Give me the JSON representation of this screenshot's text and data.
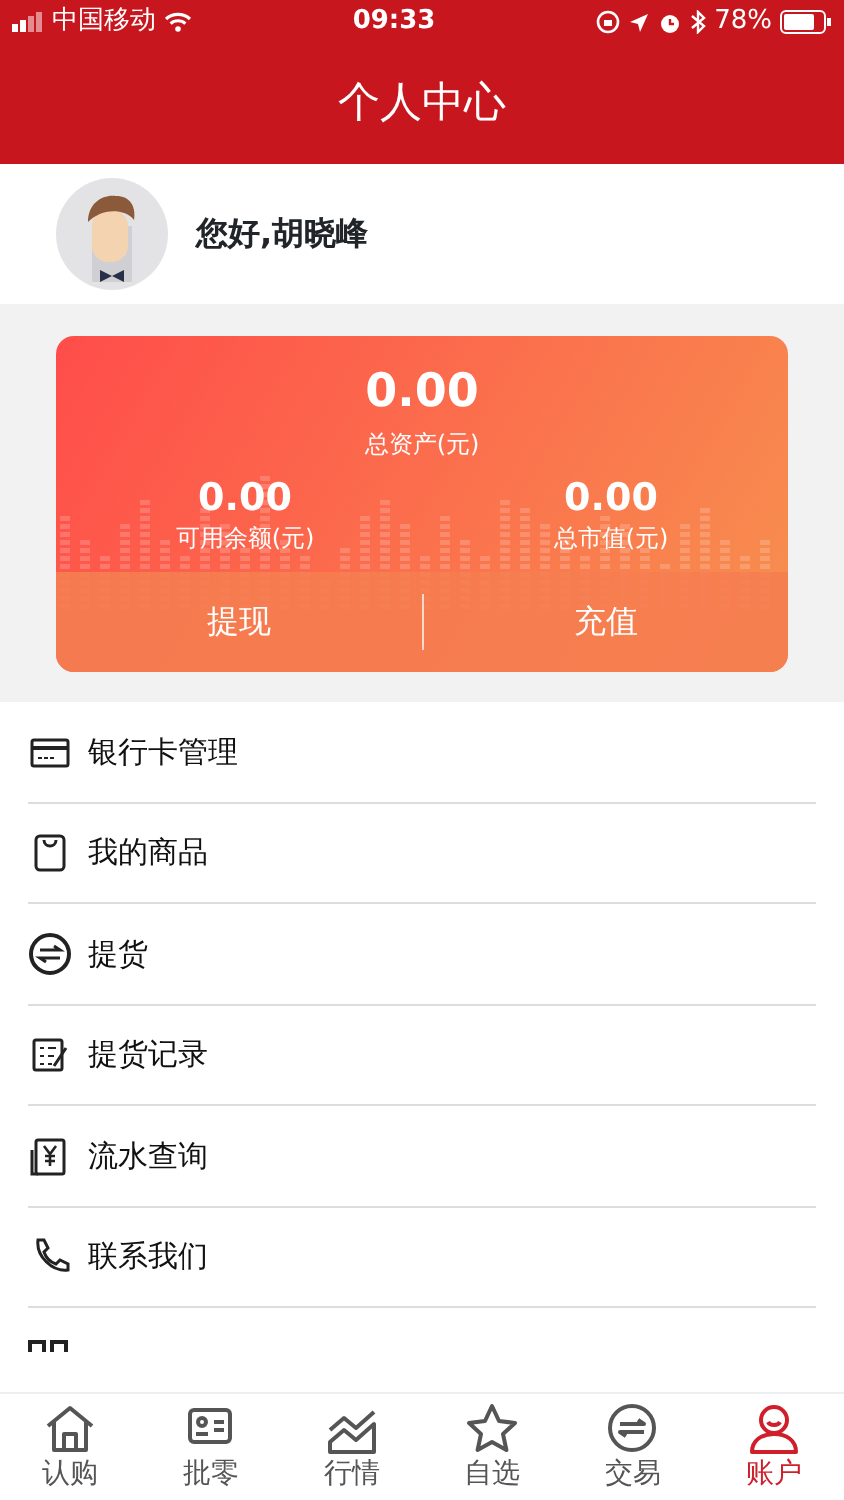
{
  "status_bar": {
    "carrier": "中国移动",
    "time": "09:33",
    "battery": "78%"
  },
  "header": {
    "title": "个人中心"
  },
  "profile": {
    "greeting": "您好,胡晓峰"
  },
  "assets": {
    "total": {
      "value": "0.00",
      "label": "总资产(元)"
    },
    "stats": [
      {
        "value": "0.00",
        "label": "可用余额(元)"
      },
      {
        "value": "0.00",
        "label": "总市值(元)"
      }
    ],
    "actions": [
      "提现",
      "充值"
    ]
  },
  "menu": [
    {
      "label": "银行卡管理"
    },
    {
      "label": "我的商品"
    },
    {
      "label": "提货"
    },
    {
      "label": "提货记录"
    },
    {
      "label": "流水查询"
    },
    {
      "label": "联系我们"
    }
  ],
  "tabs": [
    {
      "label": "认购",
      "selected": false
    },
    {
      "label": "批零",
      "selected": false
    },
    {
      "label": "行情",
      "selected": false
    },
    {
      "label": "自选",
      "selected": false
    },
    {
      "label": "交易",
      "selected": false
    },
    {
      "label": "账户",
      "selected": true
    }
  ]
}
